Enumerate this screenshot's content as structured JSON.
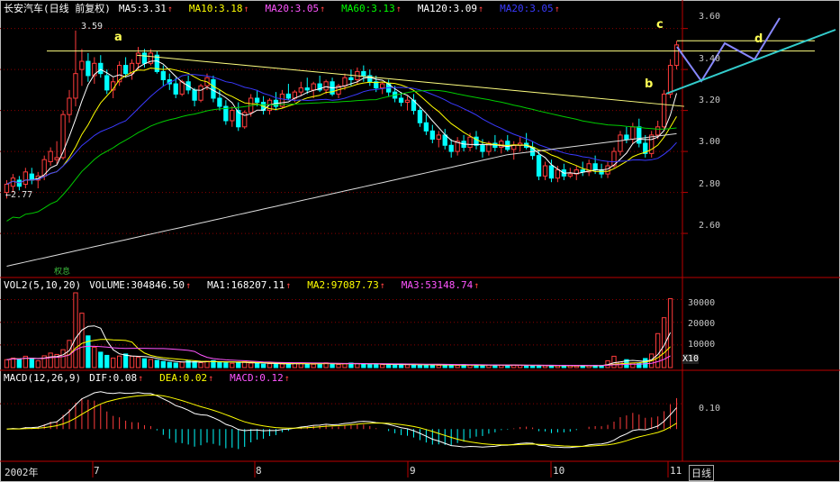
{
  "stock": {
    "name": "长安汽车(日线 前复权)"
  },
  "price_header": [
    {
      "label": "MA5",
      "value": "3.31",
      "color": "#ffffff"
    },
    {
      "label": "MA10",
      "value": "3.18",
      "color": "#ffff00"
    },
    {
      "label": "MA20",
      "value": "3.05",
      "color": "#ff55ff"
    },
    {
      "label": "MA60",
      "value": "3.13",
      "color": "#00ff00"
    },
    {
      "label": "MA120",
      "value": "3.09",
      "color": "#ffffff"
    },
    {
      "label": "MA20",
      "value": "3.05",
      "color": "#3a3aff"
    }
  ],
  "volume_header": {
    "title": "VOL2(5,10,20)",
    "items": [
      {
        "label": "VOLUME",
        "value": "304846.50",
        "color": "#ffffff"
      },
      {
        "label": "MA1",
        "value": "168207.11",
        "color": "#ffffff"
      },
      {
        "label": "MA2",
        "value": "97087.73",
        "color": "#ffff00"
      },
      {
        "label": "MA3",
        "value": "53148.74",
        "color": "#ff55ff"
      }
    ]
  },
  "macd_header": {
    "title": "MACD(12,26,9)",
    "items": [
      {
        "label": "DIF",
        "value": "0.08",
        "color": "#ffffff"
      },
      {
        "label": "DEA",
        "value": "0.02",
        "color": "#ffff00"
      },
      {
        "label": "MACD",
        "value": "0.12",
        "color": "#ff55ff"
      }
    ]
  },
  "notes": {
    "high": "3.59",
    "low": "2.77",
    "marker": "权息",
    "volume_unit": "X10"
  },
  "pattern_labels": [
    "a",
    "b",
    "c",
    "d"
  ],
  "colors": {
    "up": "#ff3c3c",
    "down": "#00ffff",
    "grid": "#8b0000",
    "trend": "#ffff80",
    "projection": "#8888ff",
    "channel": "#33cccc"
  },
  "chart_data": [
    {
      "type": "candlestick",
      "panel": "price",
      "title": "长安汽车(日线 前复权)",
      "ylim": [
        2.42,
        3.66
      ],
      "y_ticks": [
        "3.60",
        "3.40",
        "3.20",
        "3.00",
        "2.80",
        "2.60"
      ],
      "x_ticks": [
        "2002年",
        "7",
        "8",
        "9",
        "10",
        "11"
      ],
      "period": "日线",
      "candles": [
        [
          2.8,
          2.86,
          2.77,
          2.84
        ],
        [
          2.83,
          2.89,
          2.8,
          2.87
        ],
        [
          2.86,
          2.88,
          2.81,
          2.83
        ],
        [
          2.84,
          2.92,
          2.82,
          2.9
        ],
        [
          2.89,
          2.92,
          2.84,
          2.86
        ],
        [
          2.86,
          2.9,
          2.82,
          2.88
        ],
        [
          2.88,
          2.98,
          2.86,
          2.96
        ],
        [
          2.95,
          3.02,
          2.93,
          3
        ],
        [
          2.96,
          3.05,
          2.94,
          2.97
        ],
        [
          2.97,
          3.2,
          2.96,
          3.18
        ],
        [
          3.18,
          3.3,
          3.14,
          3.26
        ],
        [
          3.26,
          3.59,
          3.22,
          3.38
        ],
        [
          3.4,
          3.5,
          3.32,
          3.44
        ],
        [
          3.44,
          3.48,
          3.34,
          3.37
        ],
        [
          3.37,
          3.46,
          3.33,
          3.43
        ],
        [
          3.43,
          3.47,
          3.36,
          3.38
        ],
        [
          3.37,
          3.4,
          3.28,
          3.3
        ],
        [
          3.3,
          3.36,
          3.26,
          3.34
        ],
        [
          3.34,
          3.44,
          3.32,
          3.42
        ],
        [
          3.42,
          3.46,
          3.36,
          3.38
        ],
        [
          3.38,
          3.45,
          3.35,
          3.43
        ],
        [
          3.43,
          3.51,
          3.4,
          3.48
        ],
        [
          3.48,
          3.5,
          3.41,
          3.43
        ],
        [
          3.43,
          3.5,
          3.42,
          3.48
        ],
        [
          3.47,
          3.49,
          3.38,
          3.39
        ],
        [
          3.39,
          3.42,
          3.32,
          3.35
        ],
        [
          3.35,
          3.38,
          3.3,
          3.33
        ],
        [
          3.33,
          3.36,
          3.26,
          3.28
        ],
        [
          3.28,
          3.35,
          3.27,
          3.34
        ],
        [
          3.34,
          3.37,
          3.28,
          3.3
        ],
        [
          3.3,
          3.31,
          3.22,
          3.25
        ],
        [
          3.25,
          3.33,
          3.24,
          3.32
        ],
        [
          3.32,
          3.38,
          3.3,
          3.36
        ],
        [
          3.35,
          3.37,
          3.24,
          3.26
        ],
        [
          3.26,
          3.3,
          3.2,
          3.22
        ],
        [
          3.22,
          3.25,
          3.13,
          3.15
        ],
        [
          3.15,
          3.22,
          3.12,
          3.2
        ],
        [
          3.2,
          3.24,
          3.1,
          3.12
        ],
        [
          3.12,
          3.2,
          3.11,
          3.19
        ],
        [
          3.19,
          3.28,
          3.17,
          3.26
        ],
        [
          3.26,
          3.3,
          3.22,
          3.24
        ],
        [
          3.24,
          3.27,
          3.18,
          3.2
        ],
        [
          3.2,
          3.26,
          3.18,
          3.25
        ],
        [
          3.25,
          3.29,
          3.2,
          3.22
        ],
        [
          3.22,
          3.3,
          3.21,
          3.28
        ],
        [
          3.28,
          3.33,
          3.25,
          3.26
        ],
        [
          3.26,
          3.3,
          3.24,
          3.29
        ],
        [
          3.29,
          3.34,
          3.27,
          3.31
        ],
        [
          3.31,
          3.36,
          3.28,
          3.3
        ],
        [
          3.3,
          3.34,
          3.26,
          3.33
        ],
        [
          3.33,
          3.37,
          3.29,
          3.3
        ],
        [
          3.3,
          3.35,
          3.28,
          3.34
        ],
        [
          3.34,
          3.36,
          3.27,
          3.28
        ],
        [
          3.28,
          3.33,
          3.26,
          3.32
        ],
        [
          3.32,
          3.38,
          3.3,
          3.36
        ],
        [
          3.36,
          3.4,
          3.32,
          3.35
        ],
        [
          3.35,
          3.41,
          3.33,
          3.39
        ],
        [
          3.39,
          3.42,
          3.34,
          3.37
        ],
        [
          3.37,
          3.4,
          3.32,
          3.34
        ],
        [
          3.34,
          3.37,
          3.29,
          3.31
        ],
        [
          3.31,
          3.34,
          3.28,
          3.33
        ],
        [
          3.33,
          3.35,
          3.27,
          3.29
        ],
        [
          3.29,
          3.32,
          3.24,
          3.26
        ],
        [
          3.26,
          3.29,
          3.22,
          3.24
        ],
        [
          3.24,
          3.27,
          3.2,
          3.25
        ],
        [
          3.25,
          3.28,
          3.18,
          3.2
        ],
        [
          3.2,
          3.22,
          3.12,
          3.14
        ],
        [
          3.14,
          3.18,
          3.08,
          3.1
        ],
        [
          3.1,
          3.13,
          3.04,
          3.06
        ],
        [
          3.06,
          3.1,
          3.02,
          3.08
        ],
        [
          3.08,
          3.11,
          3.01,
          3.03
        ],
        [
          3.03,
          3.06,
          2.97,
          3
        ],
        [
          3,
          3.07,
          2.98,
          3.05
        ],
        [
          3.05,
          3.08,
          3,
          3.02
        ],
        [
          3.02,
          3.09,
          3,
          3.07
        ],
        [
          3.07,
          3.1,
          3.01,
          3.03
        ],
        [
          3.03,
          3.06,
          2.97,
          3
        ],
        [
          3,
          3.05,
          2.98,
          3.04
        ],
        [
          3.04,
          3.08,
          3,
          3.02
        ],
        [
          3.02,
          3.06,
          2.99,
          3.05
        ],
        [
          3.05,
          3.08,
          3,
          3.01
        ],
        [
          3.01,
          3.05,
          2.96,
          3.03
        ],
        [
          3.03,
          3.07,
          3,
          3.04
        ],
        [
          3.04,
          3.09,
          3.01,
          3.02
        ],
        [
          3.02,
          3.05,
          2.96,
          2.98
        ],
        [
          2.98,
          3,
          2.86,
          2.88
        ],
        [
          2.88,
          2.95,
          2.86,
          2.93
        ],
        [
          2.93,
          2.96,
          2.85,
          2.87
        ],
        [
          2.87,
          2.93,
          2.85,
          2.91
        ],
        [
          2.91,
          2.94,
          2.86,
          2.88
        ],
        [
          2.88,
          2.92,
          2.87,
          2.89
        ],
        [
          2.89,
          2.93,
          2.86,
          2.91
        ],
        [
          2.91,
          2.95,
          2.88,
          2.9
        ],
        [
          2.9,
          2.96,
          2.88,
          2.94
        ],
        [
          2.94,
          2.98,
          2.89,
          2.91
        ],
        [
          2.91,
          2.94,
          2.87,
          2.89
        ],
        [
          2.89,
          2.95,
          2.87,
          2.93
        ],
        [
          2.93,
          3.02,
          2.92,
          3
        ],
        [
          3,
          3.1,
          2.98,
          3.08
        ],
        [
          3.08,
          3.12,
          3.04,
          3.06
        ],
        [
          3.06,
          3.14,
          3.04,
          3.12
        ],
        [
          3.12,
          3.16,
          3.02,
          3.04
        ],
        [
          3.04,
          3.08,
          2.97,
          2.99
        ],
        [
          2.99,
          3.1,
          2.97,
          3.08
        ],
        [
          3.08,
          3.15,
          3.06,
          3.12
        ],
        [
          3.12,
          3.3,
          3.1,
          3.28
        ],
        [
          3.28,
          3.45,
          3.26,
          3.42
        ],
        [
          3.42,
          3.54,
          3.4,
          3.52
        ]
      ],
      "annotations": {
        "high_label": "3.59",
        "low_label": "2.77",
        "pattern": [
          "a",
          "b",
          "c",
          "d"
        ]
      }
    },
    {
      "type": "bar",
      "panel": "volume",
      "title": "VOL2(5,10,20)",
      "unit": "X10",
      "y_ticks": [
        "30000",
        "20000",
        "10000"
      ],
      "ylim": [
        0,
        33000
      ],
      "values": [
        3500,
        4200,
        3800,
        5000,
        4100,
        3000,
        5200,
        6400,
        5800,
        7900,
        12000,
        33000,
        24000,
        14000,
        9000,
        6800,
        5400,
        4200,
        5100,
        6000,
        5000,
        4500,
        3900,
        3600,
        3200,
        2700,
        2300,
        2000,
        2400,
        3000,
        2600,
        2200,
        2800,
        3100,
        2500,
        2100,
        1900,
        2200,
        2600,
        2000,
        1800,
        1500,
        1700,
        1900,
        1600,
        1400,
        1800,
        2000,
        1700,
        1500,
        1900,
        2100,
        1600,
        1400,
        1700,
        2000,
        1800,
        1600,
        1500,
        1400,
        1300,
        1200,
        1500,
        1400,
        1300,
        1200,
        1100,
        1300,
        1200,
        1000,
        1100,
        1200,
        1000,
        1300,
        1100,
        1000,
        900,
        1200,
        1100,
        1000,
        900,
        1100,
        1000,
        900,
        800,
        1000,
        900,
        800,
        900,
        1000,
        800,
        700,
        900,
        800,
        1000,
        900,
        3000,
        5000,
        2500,
        3500,
        2000,
        1800,
        4000,
        6000,
        15000,
        22000,
        30400
      ],
      "series": [
        {
          "name": "MA1",
          "value": "168207.11"
        },
        {
          "name": "MA2",
          "value": "97087.73"
        },
        {
          "name": "MA3",
          "value": "53148.74"
        }
      ]
    },
    {
      "type": "bar",
      "panel": "macd",
      "title": "MACD(12,26,9)",
      "y_ticks": [
        "0.10"
      ],
      "ylim": [
        -0.12,
        0.2
      ],
      "series": [
        {
          "name": "DIF",
          "value": "0.08"
        },
        {
          "name": "DEA",
          "value": "0.02"
        },
        {
          "name": "MACD",
          "value": "0.12"
        }
      ]
    }
  ]
}
